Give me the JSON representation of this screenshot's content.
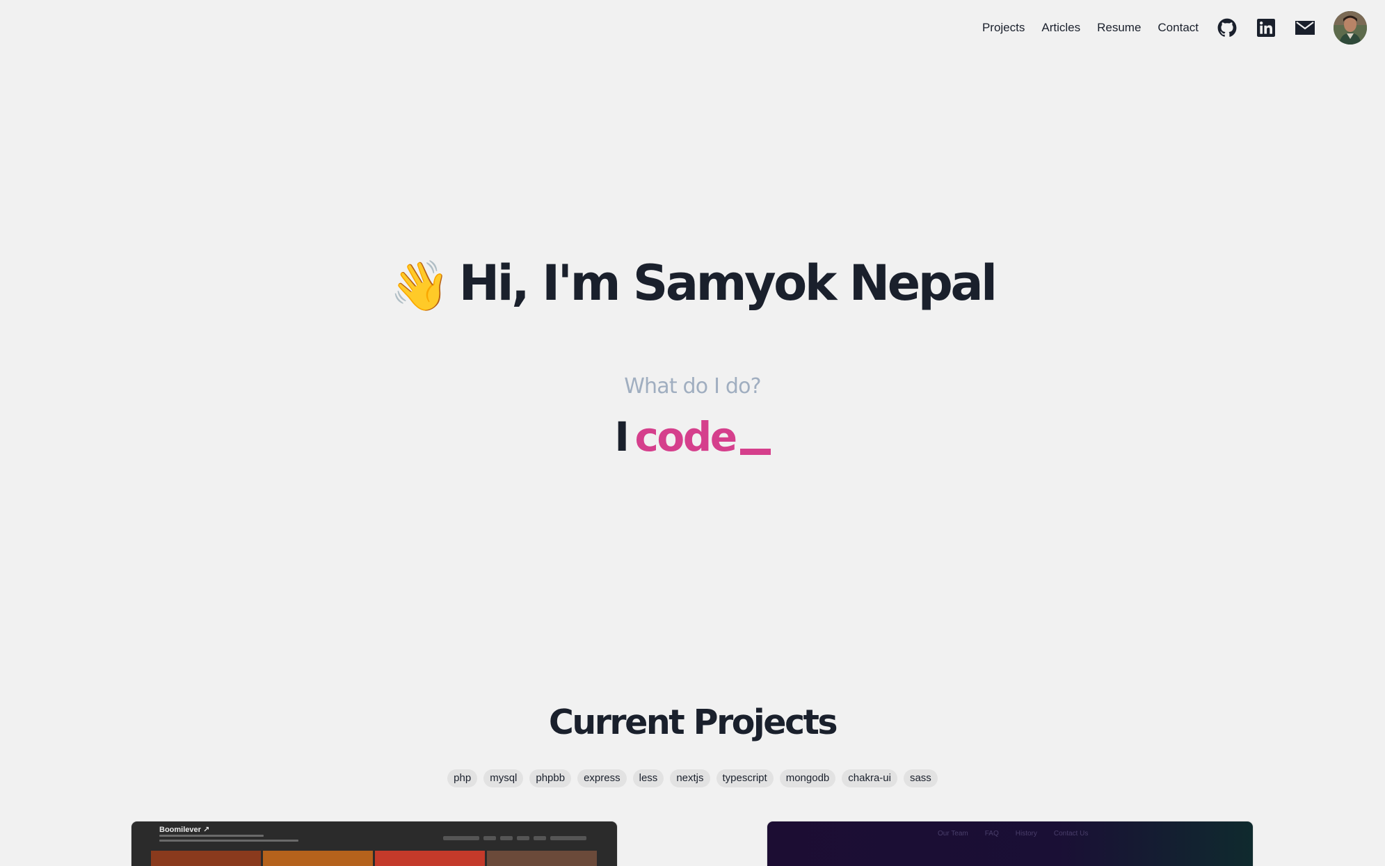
{
  "nav": {
    "links": [
      "Projects",
      "Articles",
      "Resume",
      "Contact"
    ],
    "icons": [
      "github-icon",
      "linkedin-icon",
      "mail-icon"
    ],
    "avatar": "avatar"
  },
  "hero": {
    "emoji": "👋",
    "title": "Hi, I'm Samyok Nepal",
    "subtitle": "What do I do?",
    "code_prefix": "I",
    "code_word": "code"
  },
  "projects": {
    "title": "Current Projects",
    "tags": [
      "php",
      "mysql",
      "phpbb",
      "express",
      "less",
      "nextjs",
      "typescript",
      "mongodb",
      "chakra-ui",
      "sass"
    ],
    "cards": [
      {
        "title": "Boomilever ↗"
      },
      {
        "nav": [
          "Our Team",
          "FAQ",
          "History",
          "Contact Us"
        ]
      }
    ]
  },
  "colors": {
    "background": "#f1f1f1",
    "text": "#1a202c",
    "accent": "#d53f8c",
    "muted": "#a0aec0",
    "tag_bg": "#e2e2e2"
  }
}
